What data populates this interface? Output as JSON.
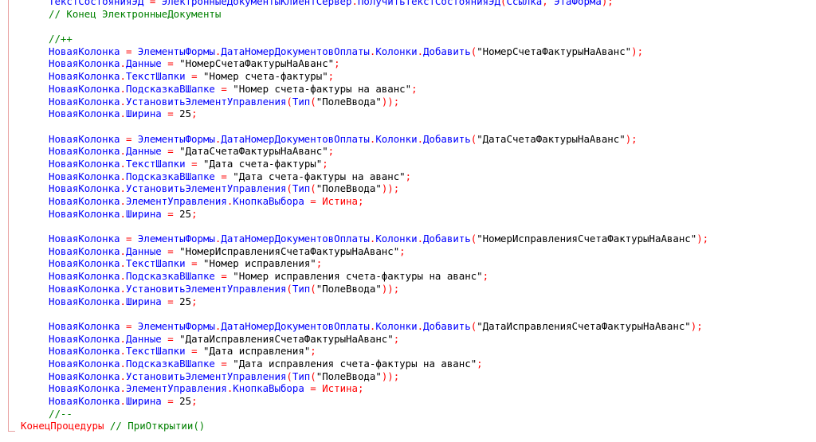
{
  "editor": {
    "lines": [
      {
        "segs": [
          [
            "id",
            "ТекстСостоянияЭД"
          ],
          [
            "op",
            " = "
          ],
          [
            "id",
            "ЭлектронныеДокументыКлиентСервер"
          ],
          [
            "op",
            "."
          ],
          [
            "id",
            "ПолучитьТекстСостоянияЭД"
          ],
          [
            "op",
            "("
          ],
          [
            "id",
            "Ссылка"
          ],
          [
            "op",
            ", "
          ],
          [
            "id",
            "ЭтаФорма"
          ],
          [
            "op",
            ");"
          ]
        ]
      },
      {
        "segs": [
          [
            "cm",
            "// Конец ЭлектронныеДокументы"
          ]
        ]
      },
      {
        "segs": []
      },
      {
        "segs": [
          [
            "cm",
            "//++"
          ]
        ]
      },
      {
        "segs": [
          [
            "id",
            "НоваяКолонка"
          ],
          [
            "op",
            " = "
          ],
          [
            "id",
            "ЭлементыФормы"
          ],
          [
            "op",
            "."
          ],
          [
            "id",
            "ДатаНомерДокументовОплаты"
          ],
          [
            "op",
            "."
          ],
          [
            "id",
            "Колонки"
          ],
          [
            "op",
            "."
          ],
          [
            "id",
            "Добавить"
          ],
          [
            "op",
            "("
          ],
          [
            "str",
            "\"НомерСчетаФактурыНаАванс\""
          ],
          [
            "op",
            ");"
          ]
        ]
      },
      {
        "segs": [
          [
            "id",
            "НоваяКолонка"
          ],
          [
            "op",
            "."
          ],
          [
            "id",
            "Данные"
          ],
          [
            "op",
            " = "
          ],
          [
            "str",
            "\"НомерСчетаФактурыНаАванс\""
          ],
          [
            "op",
            ";"
          ]
        ]
      },
      {
        "segs": [
          [
            "id",
            "НоваяКолонка"
          ],
          [
            "op",
            "."
          ],
          [
            "id",
            "ТекстШапки"
          ],
          [
            "op",
            " = "
          ],
          [
            "str",
            "\"Номер счета-фактуры\""
          ],
          [
            "op",
            ";"
          ]
        ]
      },
      {
        "segs": [
          [
            "id",
            "НоваяКолонка"
          ],
          [
            "op",
            "."
          ],
          [
            "id",
            "ПодсказкаВШапке"
          ],
          [
            "op",
            " = "
          ],
          [
            "str",
            "\"Номер счета-фактуры на аванс\""
          ],
          [
            "op",
            ";"
          ]
        ]
      },
      {
        "segs": [
          [
            "id",
            "НоваяКолонка"
          ],
          [
            "op",
            "."
          ],
          [
            "id",
            "УстановитьЭлементУправления"
          ],
          [
            "op",
            "("
          ],
          [
            "id",
            "Тип"
          ],
          [
            "op",
            "("
          ],
          [
            "str",
            "\"ПолеВвода\""
          ],
          [
            "op",
            "));"
          ]
        ]
      },
      {
        "segs": [
          [
            "id",
            "НоваяКолонка"
          ],
          [
            "op",
            "."
          ],
          [
            "id",
            "Ширина"
          ],
          [
            "op",
            " = "
          ],
          [
            "num",
            "25"
          ],
          [
            "op",
            ";"
          ]
        ]
      },
      {
        "segs": []
      },
      {
        "segs": [
          [
            "id",
            "НоваяКолонка"
          ],
          [
            "op",
            " = "
          ],
          [
            "id",
            "ЭлементыФормы"
          ],
          [
            "op",
            "."
          ],
          [
            "id",
            "ДатаНомерДокументовОплаты"
          ],
          [
            "op",
            "."
          ],
          [
            "id",
            "Колонки"
          ],
          [
            "op",
            "."
          ],
          [
            "id",
            "Добавить"
          ],
          [
            "op",
            "("
          ],
          [
            "str",
            "\"ДатаСчетаФактурыНаАванс\""
          ],
          [
            "op",
            ");"
          ]
        ]
      },
      {
        "segs": [
          [
            "id",
            "НоваяКолонка"
          ],
          [
            "op",
            "."
          ],
          [
            "id",
            "Данные"
          ],
          [
            "op",
            " = "
          ],
          [
            "str",
            "\"ДатаСчетаФактурыНаАванс\""
          ],
          [
            "op",
            ";"
          ]
        ]
      },
      {
        "segs": [
          [
            "id",
            "НоваяКолонка"
          ],
          [
            "op",
            "."
          ],
          [
            "id",
            "ТекстШапки"
          ],
          [
            "op",
            " = "
          ],
          [
            "str",
            "\"Дата счета-фактуры\""
          ],
          [
            "op",
            ";"
          ]
        ]
      },
      {
        "segs": [
          [
            "id",
            "НоваяКолонка"
          ],
          [
            "op",
            "."
          ],
          [
            "id",
            "ПодсказкаВШапке"
          ],
          [
            "op",
            " = "
          ],
          [
            "str",
            "\"Дата счета-фактуры на аванс\""
          ],
          [
            "op",
            ";"
          ]
        ]
      },
      {
        "segs": [
          [
            "id",
            "НоваяКолонка"
          ],
          [
            "op",
            "."
          ],
          [
            "id",
            "УстановитьЭлементУправления"
          ],
          [
            "op",
            "("
          ],
          [
            "id",
            "Тип"
          ],
          [
            "op",
            "("
          ],
          [
            "str",
            "\"ПолеВвода\""
          ],
          [
            "op",
            "));"
          ]
        ]
      },
      {
        "segs": [
          [
            "id",
            "НоваяКолонка"
          ],
          [
            "op",
            "."
          ],
          [
            "id",
            "ЭлементУправления"
          ],
          [
            "op",
            "."
          ],
          [
            "id",
            "КнопкаВыбора"
          ],
          [
            "op",
            " = "
          ],
          [
            "kw",
            "Истина"
          ],
          [
            "op",
            ";"
          ]
        ]
      },
      {
        "segs": [
          [
            "id",
            "НоваяКолонка"
          ],
          [
            "op",
            "."
          ],
          [
            "id",
            "Ширина"
          ],
          [
            "op",
            " = "
          ],
          [
            "num",
            "25"
          ],
          [
            "op",
            ";"
          ]
        ]
      },
      {
        "segs": []
      },
      {
        "segs": [
          [
            "id",
            "НоваяКолонка"
          ],
          [
            "op",
            " = "
          ],
          [
            "id",
            "ЭлементыФормы"
          ],
          [
            "op",
            "."
          ],
          [
            "id",
            "ДатаНомерДокументовОплаты"
          ],
          [
            "op",
            "."
          ],
          [
            "id",
            "Колонки"
          ],
          [
            "op",
            "."
          ],
          [
            "id",
            "Добавить"
          ],
          [
            "op",
            "("
          ],
          [
            "str",
            "\"НомерИсправленияСчетаФактурыНаАванс\""
          ],
          [
            "op",
            ");"
          ]
        ]
      },
      {
        "segs": [
          [
            "id",
            "НоваяКолонка"
          ],
          [
            "op",
            "."
          ],
          [
            "id",
            "Данные"
          ],
          [
            "op",
            " = "
          ],
          [
            "str",
            "\"НомерИсправленияСчетаФактурыНаАванс\""
          ],
          [
            "op",
            ";"
          ]
        ]
      },
      {
        "segs": [
          [
            "id",
            "НоваяКолонка"
          ],
          [
            "op",
            "."
          ],
          [
            "id",
            "ТекстШапки"
          ],
          [
            "op",
            " = "
          ],
          [
            "str",
            "\"Номер исправления\""
          ],
          [
            "op",
            ";"
          ]
        ]
      },
      {
        "segs": [
          [
            "id",
            "НоваяКолонка"
          ],
          [
            "op",
            "."
          ],
          [
            "id",
            "ПодсказкаВШапке"
          ],
          [
            "op",
            " = "
          ],
          [
            "str",
            "\"Номер исправления счета-фактуры на аванс\""
          ],
          [
            "op",
            ";"
          ]
        ]
      },
      {
        "segs": [
          [
            "id",
            "НоваяКолонка"
          ],
          [
            "op",
            "."
          ],
          [
            "id",
            "УстановитьЭлементУправления"
          ],
          [
            "op",
            "("
          ],
          [
            "id",
            "Тип"
          ],
          [
            "op",
            "("
          ],
          [
            "str",
            "\"ПолеВвода\""
          ],
          [
            "op",
            "));"
          ]
        ]
      },
      {
        "segs": [
          [
            "id",
            "НоваяКолонка"
          ],
          [
            "op",
            "."
          ],
          [
            "id",
            "Ширина"
          ],
          [
            "op",
            " = "
          ],
          [
            "num",
            "25"
          ],
          [
            "op",
            ";"
          ]
        ]
      },
      {
        "segs": []
      },
      {
        "segs": [
          [
            "id",
            "НоваяКолонка"
          ],
          [
            "op",
            " = "
          ],
          [
            "id",
            "ЭлементыФормы"
          ],
          [
            "op",
            "."
          ],
          [
            "id",
            "ДатаНомерДокументовОплаты"
          ],
          [
            "op",
            "."
          ],
          [
            "id",
            "Колонки"
          ],
          [
            "op",
            "."
          ],
          [
            "id",
            "Добавить"
          ],
          [
            "op",
            "("
          ],
          [
            "str",
            "\"ДатаИсправленияСчетаФактурыНаАванс\""
          ],
          [
            "op",
            ");"
          ]
        ]
      },
      {
        "segs": [
          [
            "id",
            "НоваяКолонка"
          ],
          [
            "op",
            "."
          ],
          [
            "id",
            "Данные"
          ],
          [
            "op",
            " = "
          ],
          [
            "str",
            "\"ДатаИсправленияСчетаФактурыНаАванс\""
          ],
          [
            "op",
            ";"
          ]
        ]
      },
      {
        "segs": [
          [
            "id",
            "НоваяКолонка"
          ],
          [
            "op",
            "."
          ],
          [
            "id",
            "ТекстШапки"
          ],
          [
            "op",
            " = "
          ],
          [
            "str",
            "\"Дата исправления\""
          ],
          [
            "op",
            ";"
          ]
        ]
      },
      {
        "segs": [
          [
            "id",
            "НоваяКолонка"
          ],
          [
            "op",
            "."
          ],
          [
            "id",
            "ПодсказкаВШапке"
          ],
          [
            "op",
            " = "
          ],
          [
            "str",
            "\"Дата исправления счета-фактуры на аванс\""
          ],
          [
            "op",
            ";"
          ]
        ]
      },
      {
        "segs": [
          [
            "id",
            "НоваяКолонка"
          ],
          [
            "op",
            "."
          ],
          [
            "id",
            "УстановитьЭлементУправления"
          ],
          [
            "op",
            "("
          ],
          [
            "id",
            "Тип"
          ],
          [
            "op",
            "("
          ],
          [
            "str",
            "\"ПолеВвода\""
          ],
          [
            "op",
            "));"
          ]
        ]
      },
      {
        "segs": [
          [
            "id",
            "НоваяКолонка"
          ],
          [
            "op",
            "."
          ],
          [
            "id",
            "ЭлементУправления"
          ],
          [
            "op",
            "."
          ],
          [
            "id",
            "КнопкаВыбора"
          ],
          [
            "op",
            " = "
          ],
          [
            "kw",
            "Истина"
          ],
          [
            "op",
            ";"
          ]
        ]
      },
      {
        "segs": [
          [
            "id",
            "НоваяКолонка"
          ],
          [
            "op",
            "."
          ],
          [
            "id",
            "Ширина"
          ],
          [
            "op",
            " = "
          ],
          [
            "num",
            "25"
          ],
          [
            "op",
            ";"
          ]
        ]
      },
      {
        "segs": [
          [
            "cm",
            "//--"
          ]
        ]
      },
      {
        "root": true,
        "segs": [
          [
            "kw",
            "КонецПроцедуры"
          ],
          [
            "cm",
            " // ПриОткрытии()"
          ]
        ]
      }
    ]
  },
  "colors": {
    "keyword": "#ff0000",
    "identifier": "#0000ff",
    "operator": "#ff0000",
    "string": "#000000",
    "comment": "#008000",
    "gutter": "#e8a0a0"
  }
}
